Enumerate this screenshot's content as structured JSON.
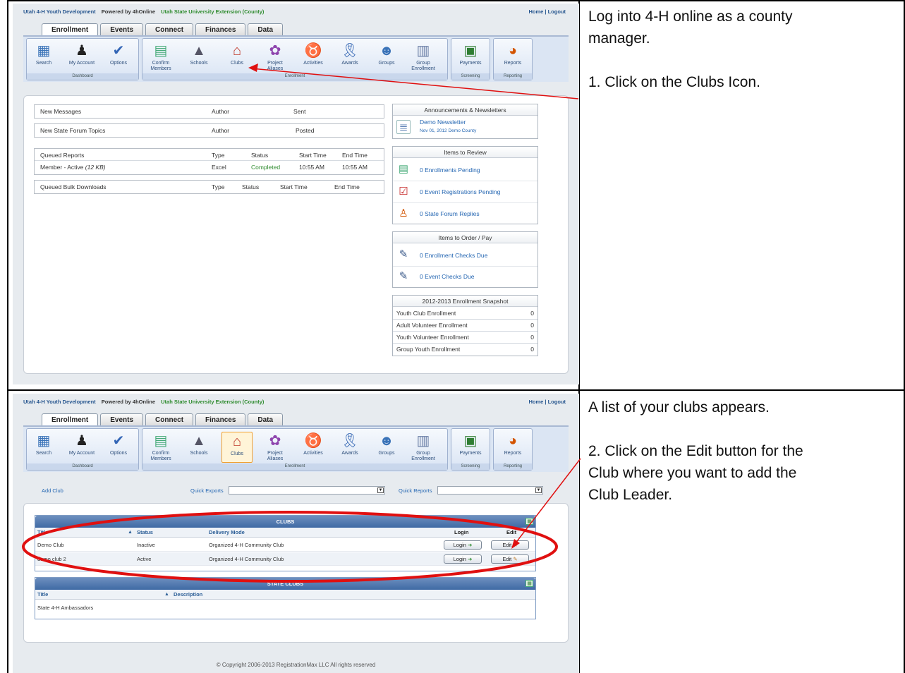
{
  "notes": {
    "row1_line1": "Log into 4-H online as a county",
    "row1_line2": "manager.",
    "row1_step": "1. Click on the Clubs Icon.",
    "row2_intro": "A list of your clubs appears.",
    "row2_step_l1": "2. Click on the Edit button for the",
    "row2_step_l2": "Club where you want to add the",
    "row2_step_l3": "Club Leader."
  },
  "header": {
    "org": "Utah 4-H Youth Development",
    "powered": "Powered by 4hOnline",
    "ext": "Utah State University Extension (County)",
    "home_logout": "Home | Logout"
  },
  "tabs": [
    "Enrollment",
    "Events",
    "Connect",
    "Finances",
    "Data"
  ],
  "ribbon": {
    "search": "Search",
    "my_account": "My Account",
    "options": "Options",
    "dashboard": "Dashboard",
    "confirm": "Confirm",
    "members": "Members",
    "schools": "Schools",
    "clubs": "Clubs",
    "project": "Project",
    "aliases": "Aliases",
    "activities": "Activities",
    "awards": "Awards",
    "groups": "Groups",
    "group": "Group",
    "enrollment_lbl": "Enrollment",
    "enrollment_cap": "Enrollment",
    "payments": "Payments",
    "screening": "Screening",
    "reports": "Reports",
    "reporting": "Reporting"
  },
  "dashboard": {
    "new_messages": "New Messages",
    "author": "Author",
    "sent": "Sent",
    "forum": "New State Forum Topics",
    "posted": "Posted",
    "queued_reports": "Queued Reports",
    "type": "Type",
    "status": "Status",
    "start_time": "Start Time",
    "end_time": "End Time",
    "report_name": "Member - Active",
    "report_size": "(12 KB)",
    "report_type": "Excel",
    "report_status": "Completed",
    "report_start": "10:55 AM",
    "report_end": "10:55 AM",
    "bulk": "Queued Bulk Downloads"
  },
  "sidebar": {
    "ann_title": "Announcements & Newsletters",
    "newsletter": "Demo Newsletter",
    "newsletter_date": "Nov 01, 2012 Demo County",
    "review_title": "Items to Review",
    "enroll_pending": "0 Enrollments Pending",
    "event_pending": "0 Event Registrations Pending",
    "forum_replies": "0 State Forum Replies",
    "order_title": "Items to Order / Pay",
    "enroll_checks": "0 Enrollment Checks Due",
    "event_checks": "0 Event Checks Due",
    "snapshot_title": "2012-2013 Enrollment Snapshot",
    "snapshot": [
      {
        "label": "Youth Club Enrollment",
        "value": "0"
      },
      {
        "label": "Adult Volunteer Enrollment",
        "value": "0"
      },
      {
        "label": "Youth Volunteer Enrollment",
        "value": "0"
      },
      {
        "label": "Group Youth Enrollment",
        "value": "0"
      }
    ]
  },
  "clubs_page": {
    "add_club": "Add Club",
    "quick_exports": "Quick Exports",
    "quick_reports": "Quick Reports",
    "clubs_title": "CLUBS",
    "col_title": "Title",
    "col_status": "Status",
    "col_delivery": "Delivery Mode",
    "col_login": "Login",
    "col_edit": "Edit",
    "rows": [
      {
        "title": "Demo Club",
        "status": "Inactive",
        "mode": "Organized 4-H Community Club",
        "login": "Login",
        "edit": "Edit"
      },
      {
        "title": "demo club 2",
        "status": "Active",
        "mode": "Organized 4-H Community Club",
        "login": "Login",
        "edit": "Edit"
      }
    ],
    "state_title": "STATE CLUBS",
    "col_description": "Description",
    "state_rows": [
      "State 4-H Ambassadors"
    ],
    "copyright": "© Copyright 2006-2013 RegistrationMax LLC All rights reserved"
  },
  "colors": {
    "annotation": "#e01010",
    "link": "#2466b2",
    "header_blue": "#27568f"
  }
}
